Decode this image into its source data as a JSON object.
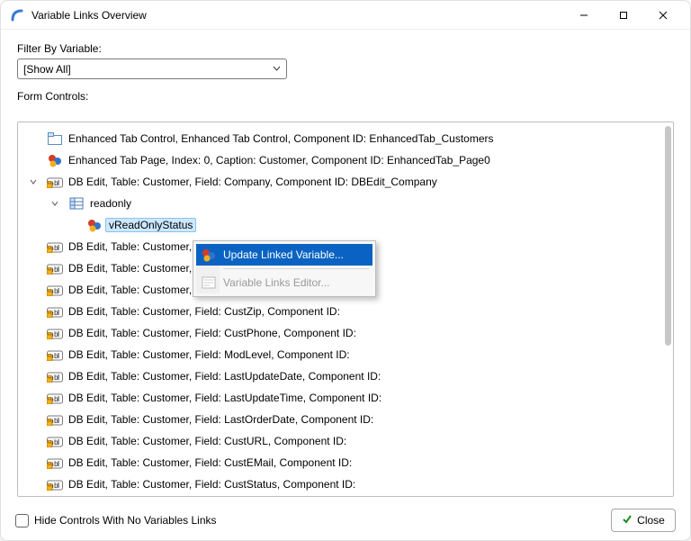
{
  "window": {
    "title": "Variable Links Overview"
  },
  "filter": {
    "label": "Filter By Variable:",
    "value": "[Show All]"
  },
  "form_controls_label": "Form Controls:",
  "tree": {
    "n0": "Enhanced Tab Control, Enhanced Tab Control, Component ID: EnhancedTab_Customers",
    "n1": "Enhanced Tab Page, Index: 0, Caption: Customer, Component ID: EnhancedTab_Page0",
    "n2": "DB Edit, Table: Customer, Field: Company, Component ID: DBEdit_Company",
    "n2a": "readonly",
    "n2a1": "vReadOnlyStatus",
    "n3": "DB Edit, Table: Customer, F",
    "n4": "DB Edit, Table: Customer, F",
    "n5": "DB Edit, Table: Customer, Field: CustState, Component ID:",
    "n6": "DB Edit, Table: Customer, Field: CustZip, Component ID:",
    "n7": "DB Edit, Table: Customer, Field: CustPhone, Component ID:",
    "n8": "DB Edit, Table: Customer, Field: ModLevel, Component ID:",
    "n9": "DB Edit, Table: Customer, Field: LastUpdateDate, Component ID:",
    "n10": "DB Edit, Table: Customer, Field: LastUpdateTime, Component ID:",
    "n11": "DB Edit, Table: Customer, Field: LastOrderDate, Component ID:",
    "n12": "DB Edit, Table: Customer, Field: CustURL, Component ID:",
    "n13": "DB Edit, Table: Customer, Field: CustEMail, Component ID:",
    "n14": "DB Edit, Table: Customer, Field: CustStatus, Component ID:"
  },
  "context_menu": {
    "item1": "Update Linked Variable...",
    "item2": "Variable Links Editor..."
  },
  "footer": {
    "checkbox_label": "Hide Controls With No Variables Links",
    "close": "Close"
  }
}
